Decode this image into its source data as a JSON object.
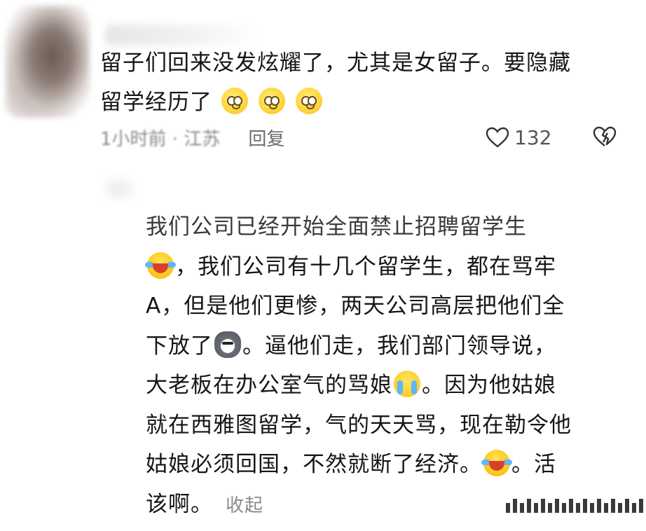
{
  "comment1": {
    "text_line1": "留子们回来没发炫耀了，尤其是女留子。要隐藏",
    "text_line2": "留学经历了",
    "emojis": [
      "pleading-face-icon",
      "pleading-face-icon",
      "pleading-face-icon"
    ],
    "time_location": "1小时前 · 江苏",
    "reply_label": "回复",
    "like_count": "132"
  },
  "comment2": {
    "line1": "我们公司已经开始全面禁止招聘留学生",
    "line2_after_emoji": "，我们公司有十几个留学生，都在骂牢",
    "line3": "A，但是他们更惨，两天公司高层把他们全",
    "line4_before_emoji": "下放了",
    "line4_after_emoji": "。逼他们走，我们部门领导说，",
    "line5_before_emoji": "大老板在办公室气的骂娘",
    "line5_after_emoji": "。因为他姑娘",
    "line6": "就在西雅图留学，气的天天骂，现在勒令他",
    "line7_before_emoji": "姑娘必须回国，不然就断了经济。",
    "line7_after_emoji": "。活",
    "line8": "该啊。",
    "collapse_label": "收起"
  }
}
